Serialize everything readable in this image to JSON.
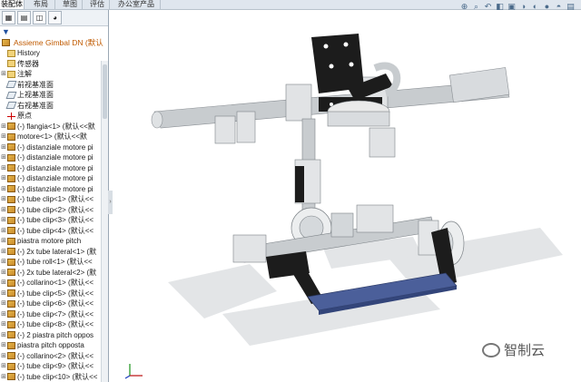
{
  "tabs": [
    "装配体",
    "布局",
    "草图",
    "评估",
    "办公室产品"
  ],
  "active_tab": 0,
  "right_toolbar_icons": [
    "zoom-fit-icon",
    "zoom-area-icon",
    "previous-view-icon",
    "section-view-icon",
    "view-orientation-icon",
    "display-style-icon",
    "hide-show-icon",
    "appearance-icon",
    "scene-icon",
    "view-settings-icon"
  ],
  "panel": {
    "tools": [
      "feature-manager-icon",
      "property-manager-icon",
      "configuration-manager-icon",
      "display-manager-icon"
    ],
    "filter_icon": "filter-icon",
    "root": "Assieme Gimbal DN (默认",
    "items": [
      {
        "label": "History",
        "icon": "folder",
        "exp": ""
      },
      {
        "label": "传感器",
        "icon": "folder",
        "exp": ""
      },
      {
        "label": "注解",
        "icon": "folder",
        "exp": "+"
      },
      {
        "label": "前视基准面",
        "icon": "plane",
        "exp": ""
      },
      {
        "label": "上视基准面",
        "icon": "plane",
        "exp": ""
      },
      {
        "label": "右视基准面",
        "icon": "plane",
        "exp": ""
      },
      {
        "label": "原点",
        "icon": "origin",
        "exp": ""
      },
      {
        "label": "(-) flangia<1> (默认<<默",
        "icon": "part",
        "exp": "+"
      },
      {
        "label": "motore<1> (默认<<默",
        "icon": "part",
        "exp": "+"
      },
      {
        "label": "(-) distanziale motore pi",
        "icon": "part",
        "exp": "+"
      },
      {
        "label": "(-) distanziale motore pi",
        "icon": "part",
        "exp": "+"
      },
      {
        "label": "(-) distanziale motore pi",
        "icon": "part",
        "exp": "+"
      },
      {
        "label": "(-) distanziale motore pi",
        "icon": "part",
        "exp": "+"
      },
      {
        "label": "(-) distanziale motore pi",
        "icon": "part",
        "exp": "+"
      },
      {
        "label": "(-) tube clip<1> (默认<<",
        "icon": "part",
        "exp": "+"
      },
      {
        "label": "(-) tube clip<2> (默认<<",
        "icon": "part",
        "exp": "+"
      },
      {
        "label": "(-) tube clip<3> (默认<<",
        "icon": "part",
        "exp": "+"
      },
      {
        "label": "(-) tube clip<4> (默认<<",
        "icon": "part",
        "exp": "+"
      },
      {
        "label": "piastra motore pitch",
        "icon": "part",
        "exp": "+"
      },
      {
        "label": "(-) 2x tube lateral<1> (默",
        "icon": "part",
        "exp": "+"
      },
      {
        "label": "(-) tube roll<1> (默认<<",
        "icon": "part",
        "exp": "+"
      },
      {
        "label": "(-) 2x tube lateral<2> (默",
        "icon": "part",
        "exp": "+"
      },
      {
        "label": "(-) collarino<1> (默认<<",
        "icon": "part",
        "exp": "+"
      },
      {
        "label": "(-) tube clip<5> (默认<<",
        "icon": "part",
        "exp": "+"
      },
      {
        "label": "(-) tube clip<6> (默认<<",
        "icon": "part",
        "exp": "+"
      },
      {
        "label": "(-) tube clip<7> (默认<<",
        "icon": "part",
        "exp": "+"
      },
      {
        "label": "(-) tube clip<8> (默认<<",
        "icon": "part",
        "exp": "+"
      },
      {
        "label": "(-) 2 piastra pitch oppos",
        "icon": "part",
        "exp": "+"
      },
      {
        "label": "piastra pitch opposta",
        "icon": "part",
        "exp": "+"
      },
      {
        "label": "(-) collarino<2> (默认<<",
        "icon": "part",
        "exp": "+"
      },
      {
        "label": "(-) tube clip<9> (默认<<",
        "icon": "part",
        "exp": "+"
      },
      {
        "label": "(-) tube clip<10> (默认<<",
        "icon": "part",
        "exp": "+"
      }
    ]
  },
  "splitter_glyph": "›",
  "watermark": {
    "text": "智制云"
  },
  "colors": {
    "tube": "#c8cccf",
    "bracket": "#1a1a1a",
    "plate": "#4b5f9a",
    "root_text": "#c05a00"
  }
}
